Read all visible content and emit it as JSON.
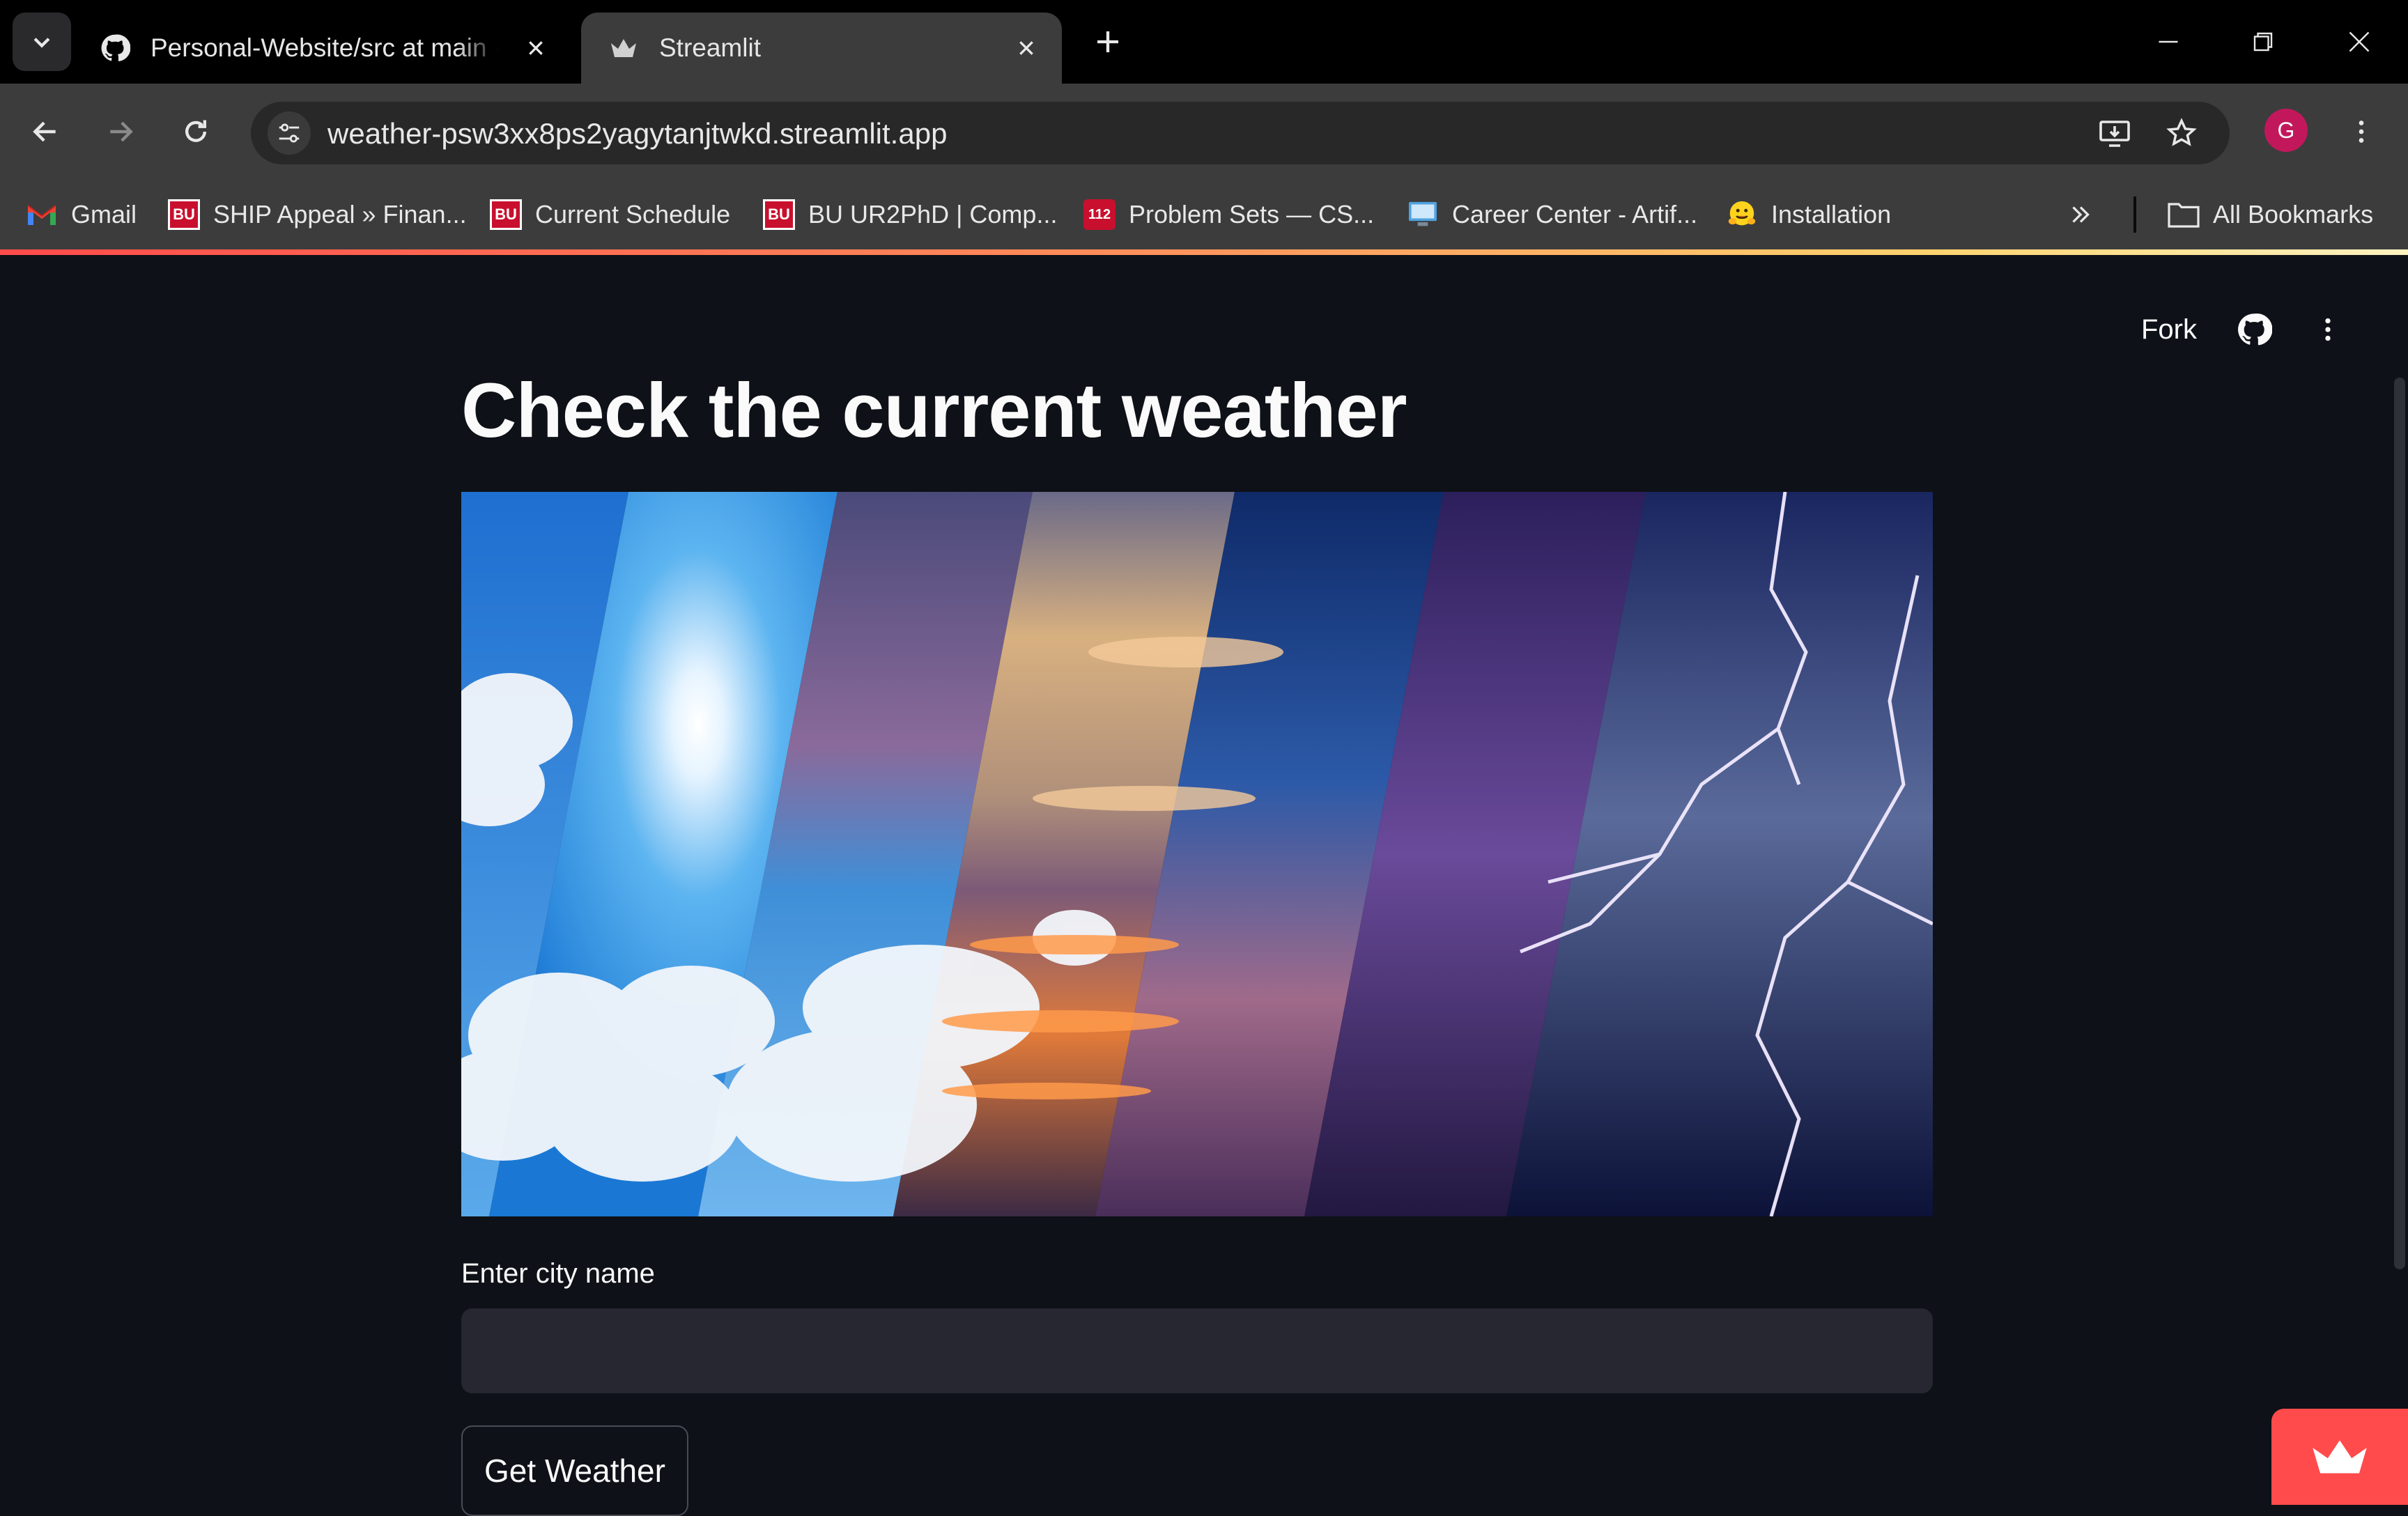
{
  "browser": {
    "tabs": [
      {
        "title": "Personal-Website/src at main · J",
        "favicon": "github-icon",
        "active": false
      },
      {
        "title": "Streamlit",
        "favicon": "streamlit-crown-icon",
        "active": true
      }
    ],
    "address_bar": {
      "url": "weather-psw3xx8ps2yagytanjtwkd.streamlit.app"
    },
    "profile_initial": "G",
    "bookmarks": [
      {
        "label": "Gmail",
        "icon": "gmail-icon"
      },
      {
        "label": "SHIP Appeal » Finan...",
        "icon": "bu-icon",
        "icon_text": "BU"
      },
      {
        "label": "Current Schedule",
        "icon": "bu-icon",
        "icon_text": "BU"
      },
      {
        "label": "BU UR2PhD | Comp...",
        "icon": "bu-icon",
        "icon_text": "BU"
      },
      {
        "label": "Problem Sets — CS...",
        "icon": "course-112-icon",
        "icon_text": "112"
      },
      {
        "label": "Career Center - Artif...",
        "icon": "monitor-icon"
      },
      {
        "label": "Installation",
        "icon": "hugging-face-icon"
      }
    ],
    "all_bookmarks_label": "All Bookmarks"
  },
  "app": {
    "header": {
      "fork_label": "Fork"
    },
    "title": "Check the current weather",
    "city_input": {
      "label": "Enter city name",
      "value": "",
      "placeholder": ""
    },
    "submit_button": {
      "label": "Get Weather"
    }
  },
  "colors": {
    "app_background": "#0e1117",
    "input_background": "#262730",
    "streamlit_accent": "#ff4b4b",
    "browser_chrome": "#3c3c3c"
  }
}
